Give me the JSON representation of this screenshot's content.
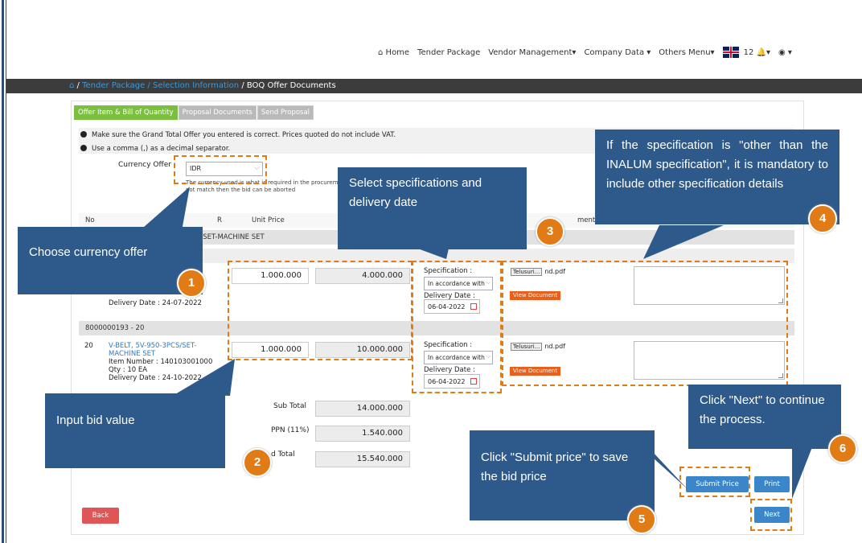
{
  "nav": {
    "home": "Home",
    "tender_package": "Tender Package",
    "vendor_management": "Vendor Management",
    "company_data": "Company Data",
    "others_menu": "Others Menu",
    "notif_count": "12"
  },
  "breadcrumb": {
    "tender": "Tender Package / Selection Information",
    "current": "/ BOQ Offer Documents",
    "sep": "/"
  },
  "tabs": [
    "Offer Item & Bill of Quantity",
    "Proposal Documents",
    "Send Proposal"
  ],
  "notices": [
    "Make sure the Grand Total Offer you entered is correct. Prices quoted do not include VAT.",
    "Use a comma (,) as a decimal separator."
  ],
  "currency": {
    "label": "Currency Offer :",
    "value": "IDR",
    "help1": "The currency used is what is required in the procurem",
    "help2": "not match then the bid can be aborted"
  },
  "table": {
    "col_no": "No",
    "col_r": "R",
    "col_unit_price": "Unit Price",
    "col_ment": "ment"
  },
  "groups": [
    "CS/SET-MACHINE SET",
    "8000000193 - 20"
  ],
  "rows": [
    {
      "delivery": "Delivery Date : 24-07-2022",
      "unit_price": "1.000.000",
      "total": "4.000.000",
      "spec_label": "Specification :",
      "spec_value": "In accordance with",
      "date_label": "Delivery Date :",
      "date_value": "06-04-2022",
      "file": "nd.pdf",
      "file_btn": "Telusuri...",
      "view": "View Document"
    },
    {
      "no": "20",
      "name1": "V-BELT, 5V-950-3PCS/SET-",
      "name2": "MACHINE SET",
      "item_number": "Item Number : 140103001000",
      "qty": "Qty : 10 EA",
      "delivery": "Delivery Date : 24-10-2022",
      "unit_price": "1.000.000",
      "total": "10.000.000",
      "spec_label": "Specification :",
      "spec_value": "In accordance with",
      "date_label": "Delivery Date :",
      "date_value": "06-04-2022",
      "file": "nd.pdf",
      "file_btn": "Telusuri...",
      "view": "View Document"
    }
  ],
  "totals": {
    "sub_label": "Sub Total",
    "sub": "14.000.000",
    "ppn_label": "PPN (11%)",
    "ppn": "1.540.000",
    "grand_label": "d Total",
    "grand": "15.540.000"
  },
  "buttons": {
    "back": "Back",
    "submit": "Submit Price",
    "print": "Print",
    "next": "Next"
  },
  "callouts": {
    "c1": "Choose currency offer",
    "c2": "Input bid value",
    "c3": "Select specifications and delivery date",
    "c4": "If the specification is \"other than the INALUM specification\", it is mandatory to include other specification details",
    "c5": "Click \"Submit price\" to save the bid price",
    "c6": "Click \"Next\" to continue the process."
  },
  "numbers": [
    "1",
    "2",
    "3",
    "4",
    "5",
    "6"
  ],
  "colors": {
    "callout": "#2d5a8b",
    "badge": "#e07b16",
    "tab_active": "#7bbf3f",
    "btn_blue": "#3a86c8",
    "btn_red": "#e05555"
  }
}
